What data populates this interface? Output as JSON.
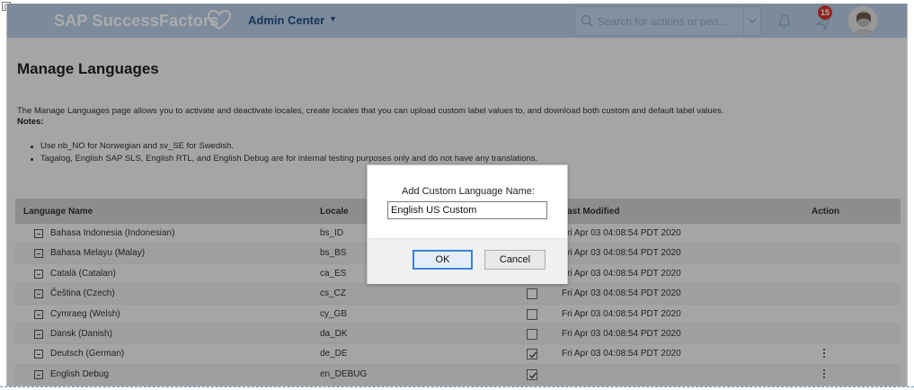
{
  "header": {
    "brand": "SAP SuccessFactors",
    "admin_center": "Admin Center",
    "search_placeholder": "Search for actions or peo...",
    "notification_count": "15"
  },
  "page": {
    "title": "Manage Languages",
    "description": "The Manage Languages page allows you to activate and deactivate locales, create locales that you can upload custom label values to, and download both custom and default label values.",
    "notes_label": "Notes:",
    "notes": [
      "Use nb_NO for Norwegian and sv_SE for Swedish.",
      "Tagalog, English SAP SLS, English RTL, and English Debug are for internal testing purposes only and do not have any translations."
    ]
  },
  "table": {
    "columns": {
      "name": "Language Name",
      "locale": "Locale",
      "modified": "Last Modified",
      "action": "Action"
    },
    "rows": [
      {
        "name": "Bahasa Indonesia (Indonesian)",
        "locale": "bs_ID",
        "checked": false,
        "modified": "Fri Apr 03 04:08:54 PDT 2020",
        "action": false
      },
      {
        "name": "Bahasa Melayu (Malay)",
        "locale": "bs_BS",
        "checked": false,
        "modified": "Fri Apr 03 04:08:54 PDT 2020",
        "action": false
      },
      {
        "name": "Català (Catalan)",
        "locale": "ca_ES",
        "checked": false,
        "modified": "Fri Apr 03 04:08:54 PDT 2020",
        "action": false
      },
      {
        "name": "Čeština (Czech)",
        "locale": "cs_CZ",
        "checked": false,
        "modified": "Fri Apr 03 04:08:54 PDT 2020",
        "action": false
      },
      {
        "name": "Cymraeg (Welsh)",
        "locale": "cy_GB",
        "checked": false,
        "modified": "Fri Apr 03 04:08:54 PDT 2020",
        "action": false
      },
      {
        "name": "Dansk (Danish)",
        "locale": "da_DK",
        "checked": false,
        "modified": "Fri Apr 03 04:08:54 PDT 2020",
        "action": false
      },
      {
        "name": "Deutsch (German)",
        "locale": "de_DE",
        "checked": true,
        "modified": "Fri Apr 03 04:08:54 PDT 2020",
        "action": true
      },
      {
        "name": "English Debug",
        "locale": "en_DEBUG",
        "checked": true,
        "modified": "",
        "action": true
      }
    ]
  },
  "dialog": {
    "label": "Add Custom Language Name:",
    "input_value": "English US Custom",
    "ok_label": "OK",
    "cancel_label": "Cancel"
  },
  "colors": {
    "header_bg": "#b9cfe8",
    "admin_text": "#234f86",
    "badge": "#d6382e",
    "ok_border": "#3b83d4"
  }
}
